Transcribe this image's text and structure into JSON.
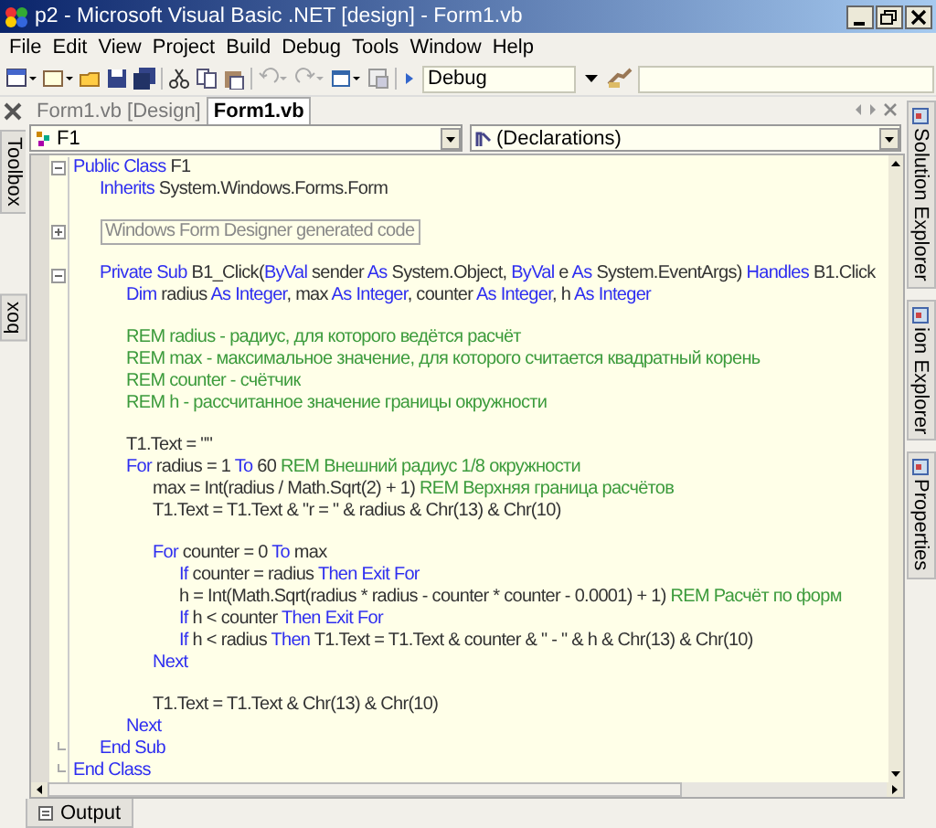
{
  "window": {
    "title": "p2 - Microsoft Visual Basic .NET [design] - Form1.vb"
  },
  "menu": [
    "File",
    "Edit",
    "View",
    "Project",
    "Build",
    "Debug",
    "Tools",
    "Window",
    "Help"
  ],
  "toolbar": {
    "configuration": "Debug"
  },
  "left_dock": [
    "Toolbox",
    "box"
  ],
  "right_dock": [
    "Solution Explorer",
    "ion Explorer",
    "Properties"
  ],
  "tabs": [
    {
      "label": "Form1.vb [Design]",
      "selected": false
    },
    {
      "label": "Form1.vb",
      "selected": true
    }
  ],
  "class_dropdown": "F1",
  "method_dropdown": "(Declarations)",
  "code": [
    {
      "kind": "code",
      "expanded": true,
      "segments": [
        {
          "kind": "keyword",
          "text": "Public Class"
        },
        {
          "kind": "plain",
          "text": " F1"
        }
      ],
      "children": [
        {
          "kind": "code",
          "segments": [
            {
              "kind": "keyword",
              "text": "Inherits"
            },
            {
              "kind": "plain",
              "text": " System.Windows.Forms.Form"
            }
          ]
        },
        {
          "kind": "blank"
        },
        {
          "kind": "region",
          "expanded": false,
          "segments": [
            {
              "kind": "region",
              "text": "Windows Form Designer generated code"
            }
          ]
        },
        {
          "kind": "blank"
        },
        {
          "kind": "code",
          "expanded": true,
          "segments": [
            {
              "kind": "keyword",
              "text": "Private Sub"
            },
            {
              "kind": "plain",
              "text": " B1_Click("
            },
            {
              "kind": "keyword",
              "text": "ByVal"
            },
            {
              "kind": "plain",
              "text": " sender "
            },
            {
              "kind": "keyword",
              "text": "As"
            },
            {
              "kind": "plain",
              "text": " System.Object, "
            },
            {
              "kind": "keyword",
              "text": "ByVal"
            },
            {
              "kind": "plain",
              "text": " e "
            },
            {
              "kind": "keyword",
              "text": "As"
            },
            {
              "kind": "plain",
              "text": " System.EventArgs) "
            },
            {
              "kind": "keyword",
              "text": "Handles"
            },
            {
              "kind": "plain",
              "text": " B1.Click"
            }
          ],
          "children": [
            {
              "kind": "code",
              "segments": [
                {
                  "kind": "keyword",
                  "text": "Dim"
                },
                {
                  "kind": "plain",
                  "text": " radius "
                },
                {
                  "kind": "keyword",
                  "text": "As Integer"
                },
                {
                  "kind": "plain",
                  "text": ", max "
                },
                {
                  "kind": "keyword",
                  "text": "As Integer"
                },
                {
                  "kind": "plain",
                  "text": ", counter "
                },
                {
                  "kind": "keyword",
                  "text": "As Integer"
                },
                {
                  "kind": "plain",
                  "text": ", h "
                },
                {
                  "kind": "keyword",
                  "text": "As Integer"
                }
              ]
            },
            {
              "kind": "blank"
            },
            {
              "kind": "code",
              "segments": [
                {
                  "kind": "comment",
                  "text": "REM radius - радиус, для которого ведётся расчёт"
                }
              ]
            },
            {
              "kind": "code",
              "segments": [
                {
                  "kind": "comment",
                  "text": "REM max - максимальное значение, для которого считается квадратный корень"
                }
              ]
            },
            {
              "kind": "code",
              "segments": [
                {
                  "kind": "comment",
                  "text": "REM counter - счётчик"
                }
              ]
            },
            {
              "kind": "code",
              "segments": [
                {
                  "kind": "comment",
                  "text": "REM h - рассчитанное значение границы окружности"
                }
              ]
            },
            {
              "kind": "blank"
            },
            {
              "kind": "code",
              "segments": [
                {
                  "kind": "plain",
                  "text": "T1.Text = \"\""
                }
              ]
            },
            {
              "kind": "code",
              "segments": [
                {
                  "kind": "keyword",
                  "text": "For"
                },
                {
                  "kind": "plain",
                  "text": " radius = 1 "
                },
                {
                  "kind": "keyword",
                  "text": "To"
                },
                {
                  "kind": "plain",
                  "text": " 60 "
                },
                {
                  "kind": "comment",
                  "text": "REM Внешний радиус 1/8 окружности"
                }
              ],
              "children": [
                {
                  "kind": "code",
                  "segments": [
                    {
                      "kind": "plain",
                      "text": "max = Int(radius / Math.Sqrt(2) + 1) "
                    },
                    {
                      "kind": "comment",
                      "text": "REM Верхняя граница расчётов"
                    }
                  ]
                },
                {
                  "kind": "code",
                  "segments": [
                    {
                      "kind": "plain",
                      "text": "T1.Text = T1.Text & \"r = \" & radius & Chr(13) & Chr(10)"
                    }
                  ]
                },
                {
                  "kind": "blank"
                },
                {
                  "kind": "code",
                  "segments": [
                    {
                      "kind": "keyword",
                      "text": "For"
                    },
                    {
                      "kind": "plain",
                      "text": " counter = 0 "
                    },
                    {
                      "kind": "keyword",
                      "text": "To"
                    },
                    {
                      "kind": "plain",
                      "text": " max"
                    }
                  ],
                  "children": [
                    {
                      "kind": "code",
                      "segments": [
                        {
                          "kind": "keyword",
                          "text": "If"
                        },
                        {
                          "kind": "plain",
                          "text": " counter = radius "
                        },
                        {
                          "kind": "keyword",
                          "text": "Then Exit For"
                        }
                      ]
                    },
                    {
                      "kind": "code",
                      "segments": [
                        {
                          "kind": "plain",
                          "text": "h = Int(Math.Sqrt(radius * radius - counter * counter - 0.0001) + 1) "
                        },
                        {
                          "kind": "comment",
                          "text": "REM Расчёт по форм"
                        }
                      ]
                    },
                    {
                      "kind": "code",
                      "segments": [
                        {
                          "kind": "keyword",
                          "text": "If"
                        },
                        {
                          "kind": "plain",
                          "text": " h < counter "
                        },
                        {
                          "kind": "keyword",
                          "text": "Then Exit For"
                        }
                      ]
                    },
                    {
                      "kind": "code",
                      "segments": [
                        {
                          "kind": "keyword",
                          "text": "If"
                        },
                        {
                          "kind": "plain",
                          "text": " h < radius "
                        },
                        {
                          "kind": "keyword",
                          "text": "Then"
                        },
                        {
                          "kind": "plain",
                          "text": " T1.Text = T1.Text & counter & \" - \" & h & Chr(13) & Chr(10)"
                        }
                      ]
                    }
                  ]
                },
                {
                  "kind": "code",
                  "segments": [
                    {
                      "kind": "keyword",
                      "text": "Next"
                    }
                  ]
                },
                {
                  "kind": "blank"
                },
                {
                  "kind": "code",
                  "segments": [
                    {
                      "kind": "plain",
                      "text": "T1.Text = T1.Text & Chr(13) & Chr(10)"
                    }
                  ]
                }
              ]
            },
            {
              "kind": "code",
              "segments": [
                {
                  "kind": "keyword",
                  "text": "Next"
                }
              ]
            }
          ]
        },
        {
          "kind": "end",
          "segments": [
            {
              "kind": "keyword",
              "text": "End Sub"
            }
          ]
        }
      ]
    },
    {
      "kind": "end",
      "segments": [
        {
          "kind": "keyword",
          "text": "End Class"
        }
      ]
    }
  ],
  "bottom_tabs": [
    "Output"
  ]
}
